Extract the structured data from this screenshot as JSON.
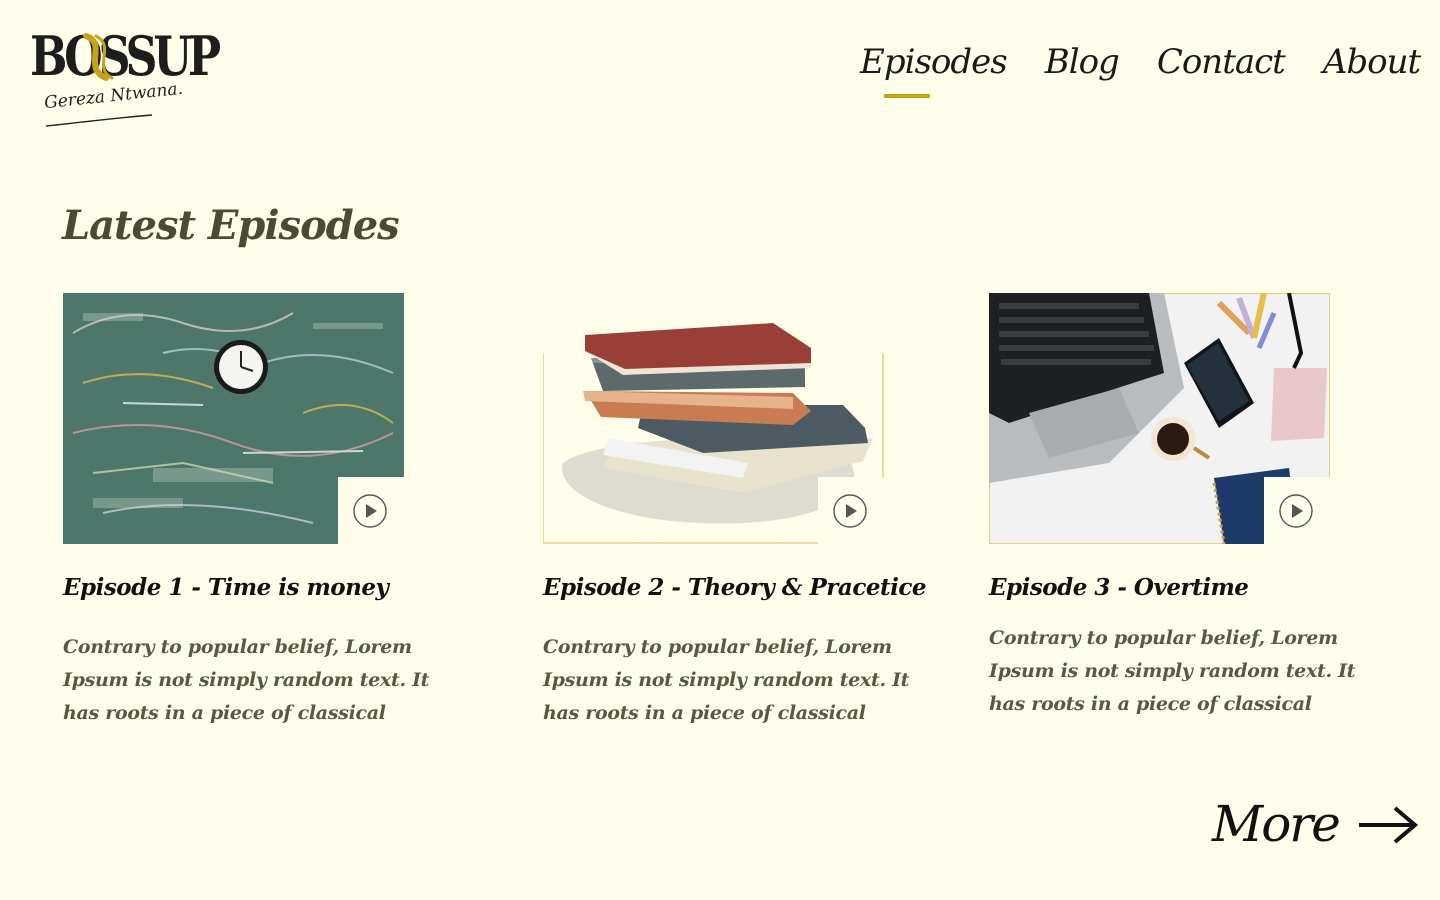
{
  "brand": {
    "logo_text": "BOSSUP",
    "signature": "Gereza Ntwana.",
    "accent_color": "#C8A316",
    "background_color": "#FEFEEB"
  },
  "nav": {
    "items": [
      {
        "label": "Episodes",
        "active": true
      },
      {
        "label": "Blog",
        "active": false
      },
      {
        "label": "Contact",
        "active": false
      },
      {
        "label": "About",
        "active": false
      }
    ]
  },
  "main": {
    "heading": "Latest Episodes",
    "episodes": [
      {
        "title": "Episode 1  - Time is money",
        "description": "Contrary to popular belief, Lorem Ipsum is not simply random text. It has roots in a piece of classical",
        "image": "chalkboard-clock-image",
        "play_icon": "play-icon"
      },
      {
        "title": "Episode 2  - Theory & Pracetice",
        "description": "Contrary to popular belief, Lorem Ipsum is not simply random text. It has roots in a piece of classical",
        "image": "book-stack-image",
        "play_icon": "play-icon"
      },
      {
        "title": "Episode 3  - Overtime",
        "description": "Contrary to popular belief, Lorem Ipsum is not simply random text. It has roots in a piece of classical",
        "image": "laptop-desk-image",
        "play_icon": "play-icon"
      }
    ]
  },
  "more": {
    "label": "More",
    "icon": "arrow-right-icon"
  }
}
